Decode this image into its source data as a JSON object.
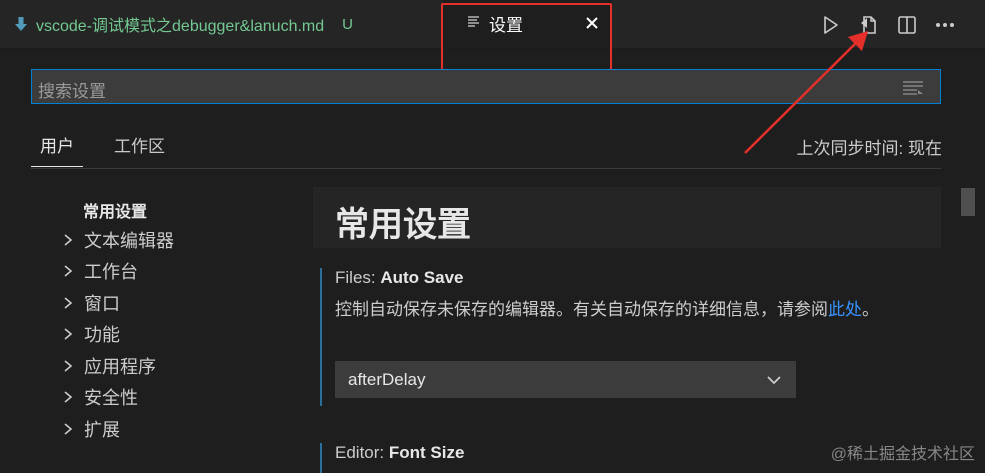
{
  "tabs": {
    "file_tab_label": "vscode-调试模式之debugger&lanuch.md",
    "file_tab_status": "U",
    "settings_tab_label": "设置"
  },
  "search": {
    "placeholder": "搜索设置"
  },
  "scope": {
    "user_tab": "用户",
    "workspace_tab": "工作区",
    "sync_status": "上次同步时间: 现在"
  },
  "toc": {
    "active": "常用设置",
    "items": [
      "文本编辑器",
      "工作台",
      "窗口",
      "功能",
      "应用程序",
      "安全性",
      "扩展"
    ]
  },
  "section": {
    "title": "常用设置"
  },
  "settings": [
    {
      "category": "Files: ",
      "name": "Auto Save",
      "description": "控制自动保存未保存的编辑器。有关自动保存的详细信息，请参阅",
      "link": "此处",
      "suffix": "。",
      "value": "afterDelay"
    },
    {
      "category": "Editor: ",
      "name": "Font Size"
    }
  ],
  "watermark": "@稀土掘金技术社区",
  "colors": {
    "accent": "#007fd4",
    "untracked": "#73c991",
    "annotation": "#e5302a"
  }
}
